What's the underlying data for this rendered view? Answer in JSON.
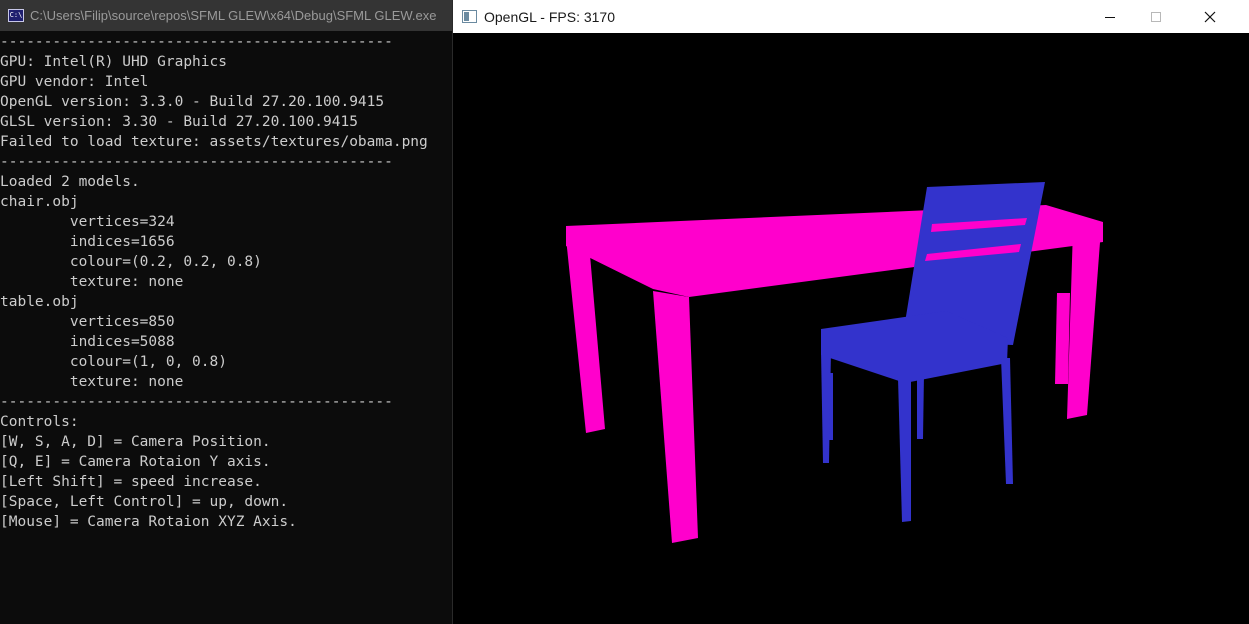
{
  "console": {
    "title": "C:\\Users\\Filip\\source\\repos\\SFML GLEW\\x64\\Debug\\SFML GLEW.exe",
    "icon": "console-app-icon",
    "lines": [
      "---------------------------------------------",
      "GPU: Intel(R) UHD Graphics",
      "GPU vendor: Intel",
      "OpenGL version: 3.3.0 - Build 27.20.100.9415",
      "GLSL version: 3.30 - Build 27.20.100.9415",
      "Failed to load texture: assets/textures/obama.png",
      "---------------------------------------------",
      "Loaded 2 models.",
      "chair.obj",
      "        vertices=324",
      "        indices=1656",
      "        colour=(0.2, 0.2, 0.8)",
      "        texture: none",
      "table.obj",
      "        vertices=850",
      "        indices=5088",
      "        colour=(1, 0, 0.8)",
      "        texture: none",
      "---------------------------------------------",
      "Controls:",
      "[W, S, A, D] = Camera Position.",
      "[Q, E] = Camera Rotaion Y axis.",
      "[Left Shift] = speed increase.",
      "[Space, Left Control] = up, down.",
      "[Mouse] = Camera Rotaion XYZ Axis."
    ]
  },
  "gl_window": {
    "title": "OpenGL - FPS: 3170",
    "icon": "window-app-icon",
    "buttons": {
      "minimize": "minimize-icon",
      "maximize": "maximize-icon",
      "close": "close-icon"
    },
    "colors": {
      "table": "#ff00cc",
      "chair": "#3333cc",
      "background": "#000000"
    }
  }
}
